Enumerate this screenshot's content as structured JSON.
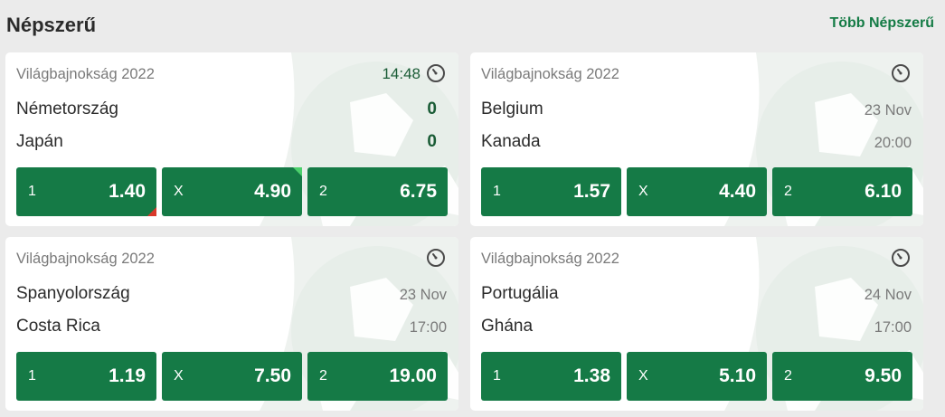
{
  "header": {
    "title": "Népszerű",
    "more_link": "Több Népszerű"
  },
  "matches": [
    {
      "competition": "Világbajnokság 2022",
      "live_time": "14:48",
      "team1": "Németország",
      "team2": "Japán",
      "score1": "0",
      "score2": "0",
      "odds": [
        {
          "label": "1",
          "value": "1.40",
          "trend": "down"
        },
        {
          "label": "X",
          "value": "4.90",
          "trend": "up"
        },
        {
          "label": "2",
          "value": "6.75",
          "trend": ""
        }
      ]
    },
    {
      "competition": "Világbajnokság 2022",
      "team1": "Belgium",
      "team2": "Kanada",
      "date": "23 Nov",
      "time": "20:00",
      "odds": [
        {
          "label": "1",
          "value": "1.57"
        },
        {
          "label": "X",
          "value": "4.40"
        },
        {
          "label": "2",
          "value": "6.10"
        }
      ]
    },
    {
      "competition": "Világbajnokság 2022",
      "team1": "Spanyolország",
      "team2": "Costa Rica",
      "date": "23 Nov",
      "time": "17:00",
      "odds": [
        {
          "label": "1",
          "value": "1.19"
        },
        {
          "label": "X",
          "value": "7.50"
        },
        {
          "label": "2",
          "value": "19.00"
        }
      ]
    },
    {
      "competition": "Világbajnokság 2022",
      "team1": "Portugália",
      "team2": "Ghána",
      "date": "24 Nov",
      "time": "17:00",
      "odds": [
        {
          "label": "1",
          "value": "1.38"
        },
        {
          "label": "X",
          "value": "5.10"
        },
        {
          "label": "2",
          "value": "9.50"
        }
      ]
    }
  ],
  "colors": {
    "accent": "#147b45",
    "odds_button": "#157a46",
    "trend_down": "#d9382a",
    "trend_up": "#4cd06c",
    "background": "#ebebeb"
  },
  "icons": {
    "clock": "clock-icon",
    "card_background": "soccer-ball-watermark"
  }
}
